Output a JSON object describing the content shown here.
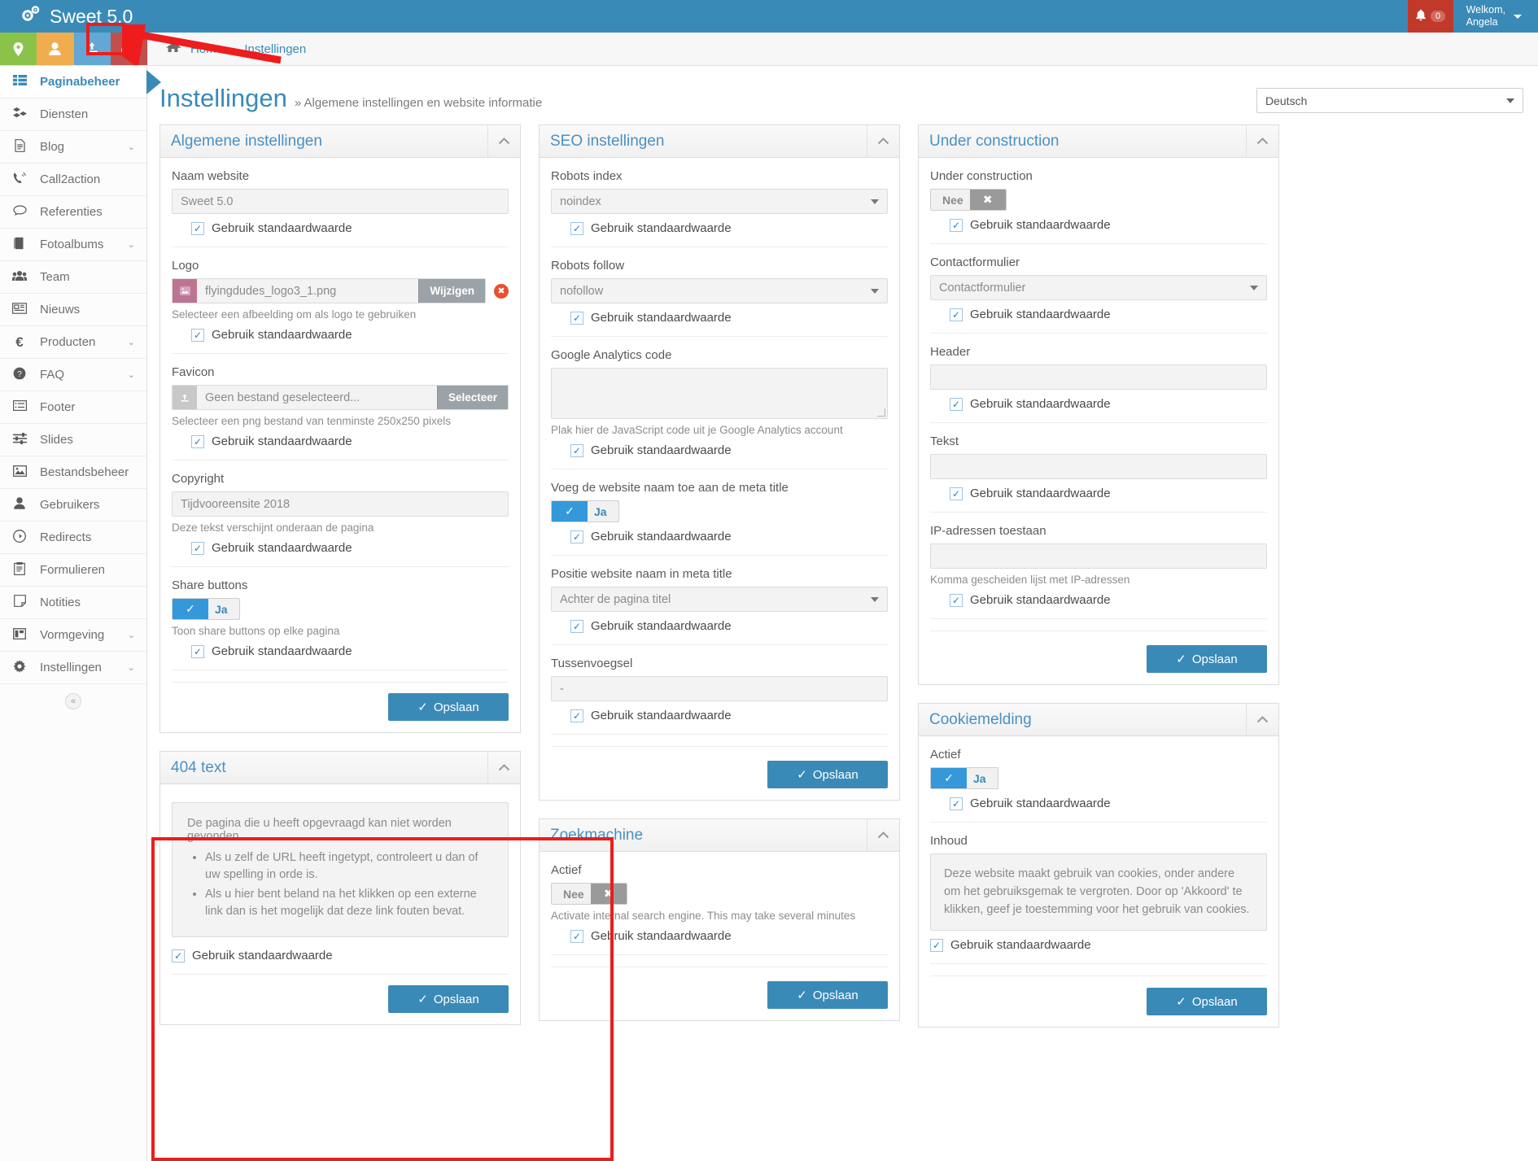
{
  "topbar": {
    "brand": "Sweet 5.0",
    "brand_icon": "gears-icon",
    "notification_count": "0",
    "welcome_line1": "Welkom,",
    "welcome_line2": "Angela"
  },
  "iconstrip": [
    {
      "name": "location-pin-icon",
      "glyph": "•",
      "color": "#8bc34a"
    },
    {
      "name": "user-icon",
      "glyph": "•",
      "color": "#f0ad4e"
    },
    {
      "name": "download-icon",
      "glyph": "•",
      "color": "#63a8d4"
    },
    {
      "name": "settings-gears-icon",
      "glyph": "•",
      "color": "#c0504d"
    }
  ],
  "breadcrumb": {
    "home": "Home",
    "separator": "›",
    "current": "Instellingen"
  },
  "sidebar": {
    "items": [
      {
        "label": "Paginabeheer",
        "icon": "grid-list-icon",
        "active": true,
        "chevron": ""
      },
      {
        "label": "Diensten",
        "icon": "boxes-icon",
        "active": false,
        "chevron": ""
      },
      {
        "label": "Blog",
        "icon": "document-icon",
        "active": false,
        "chevron": "⌄"
      },
      {
        "label": "Call2action",
        "icon": "phone-volume-icon",
        "active": false,
        "chevron": ""
      },
      {
        "label": "Referenties",
        "icon": "comment-icon",
        "active": false,
        "chevron": ""
      },
      {
        "label": "Fotoalbums",
        "icon": "book-icon",
        "active": false,
        "chevron": "⌄"
      },
      {
        "label": "Team",
        "icon": "users-icon",
        "active": false,
        "chevron": ""
      },
      {
        "label": "Nieuws",
        "icon": "newspaper-icon",
        "active": false,
        "chevron": ""
      },
      {
        "label": "Producten",
        "icon": "euro-icon",
        "active": false,
        "chevron": "⌄"
      },
      {
        "label": "FAQ",
        "icon": "question-circle-icon",
        "active": false,
        "chevron": "⌄"
      },
      {
        "label": "Footer",
        "icon": "list-icon",
        "active": false,
        "chevron": ""
      },
      {
        "label": "Slides",
        "icon": "sliders-icon",
        "active": false,
        "chevron": ""
      },
      {
        "label": "Bestandsbeheer",
        "icon": "image-icon",
        "active": false,
        "chevron": ""
      },
      {
        "label": "Gebruikers",
        "icon": "user-solid-icon",
        "active": false,
        "chevron": ""
      },
      {
        "label": "Redirects",
        "icon": "arrow-circle-right-icon",
        "active": false,
        "chevron": ""
      },
      {
        "label": "Formulieren",
        "icon": "clipboard-icon",
        "active": false,
        "chevron": ""
      },
      {
        "label": "Notities",
        "icon": "sticky-note-icon",
        "active": false,
        "chevron": ""
      },
      {
        "label": "Vormgeving",
        "icon": "layout-icon",
        "active": false,
        "chevron": "⌄"
      },
      {
        "label": "Instellingen",
        "icon": "gear-icon",
        "active": false,
        "chevron": "⌄"
      }
    ],
    "collapse_glyph": "«"
  },
  "page": {
    "title": "Instellingen",
    "subtitle": "» Algemene instellingen en website informatie",
    "language_selected": "Deutsch"
  },
  "common": {
    "use_default_label": "Gebruik standaardwaarde",
    "save_label": "Opslaan",
    "save_icon": "check-icon",
    "collapse_icon": "chevron-up-icon",
    "yes_label": "Ja",
    "no_label": "Nee"
  },
  "panels": {
    "algemene": {
      "title": "Algemene instellingen",
      "naam_website_label": "Naam website",
      "naam_website_value": "Sweet 5.0",
      "logo_label": "Logo",
      "logo_file": "flyingdudes_logo3_1.png",
      "logo_button": "Wijzigen",
      "logo_help": "Selecteer een afbeelding om als logo te gebruiken",
      "favicon_label": "Favicon",
      "favicon_file": "Geen bestand geselecteerd...",
      "favicon_button": "Selecteer",
      "favicon_help": "Selecteer een png bestand van tenminste 250x250 pixels",
      "copyright_label": "Copyright",
      "copyright_value": "Tijdvooreensite 2018",
      "copyright_help": "Deze tekst verschijnt onderaan de pagina",
      "share_label": "Share buttons",
      "share_toggle": "Ja",
      "share_help": "Toon share buttons op elke pagina"
    },
    "text404": {
      "title": "404 text",
      "body_intro": "De pagina die u heeft opgevraagd kan niet worden gevonden.",
      "bullets": [
        "Als u zelf de URL heeft ingetypt, controleert u dan of uw spelling in orde is.",
        "Als u hier bent beland na het klikken op een externe link dan is het mogelijk dat deze link fouten bevat."
      ]
    },
    "seo": {
      "title": "SEO instellingen",
      "robots_index_label": "Robots index",
      "robots_index_value": "noindex",
      "robots_follow_label": "Robots follow",
      "robots_follow_value": "nofollow",
      "ga_label": "Google Analytics code",
      "ga_value": "",
      "ga_help": "Plak hier de JavaScript code uit je Google Analytics account",
      "meta_title_label": "Voeg de website naam toe aan de meta title",
      "meta_title_toggle": "Ja",
      "position_label": "Positie website naam in meta title",
      "position_value": "Achter de pagina titel",
      "tussenvoegsel_label": "Tussenvoegsel",
      "tussenvoegsel_value": "-"
    },
    "zoekmachine": {
      "title": "Zoekmachine",
      "actief_label": "Actief",
      "actief_toggle": "Nee",
      "actief_help": "Activate internal search engine. This may take several minutes"
    },
    "under_construction": {
      "title": "Under construction",
      "uc_label": "Under construction",
      "uc_toggle": "Nee",
      "contact_label": "Contactformulier",
      "contact_value": "Contactformulier",
      "header_label": "Header",
      "header_value": "",
      "tekst_label": "Tekst",
      "tekst_value": "",
      "ip_label": "IP-adressen toestaan",
      "ip_value": "",
      "ip_help": "Komma gescheiden lijst met IP-adressen"
    },
    "cookie": {
      "title": "Cookiemelding",
      "actief_label": "Actief",
      "actief_toggle": "Ja",
      "inhoud_label": "Inhoud",
      "inhoud_value": "Deze website maakt gebruik van cookies, onder andere om het gebruiksgemak te vergroten. Door op 'Akkoord' te klikken, geef je toestemming voor het gebruik van cookies."
    }
  },
  "annotations": {
    "highlight_color": "#ee1c1c",
    "arrow_target": "settings-gears-icon"
  }
}
